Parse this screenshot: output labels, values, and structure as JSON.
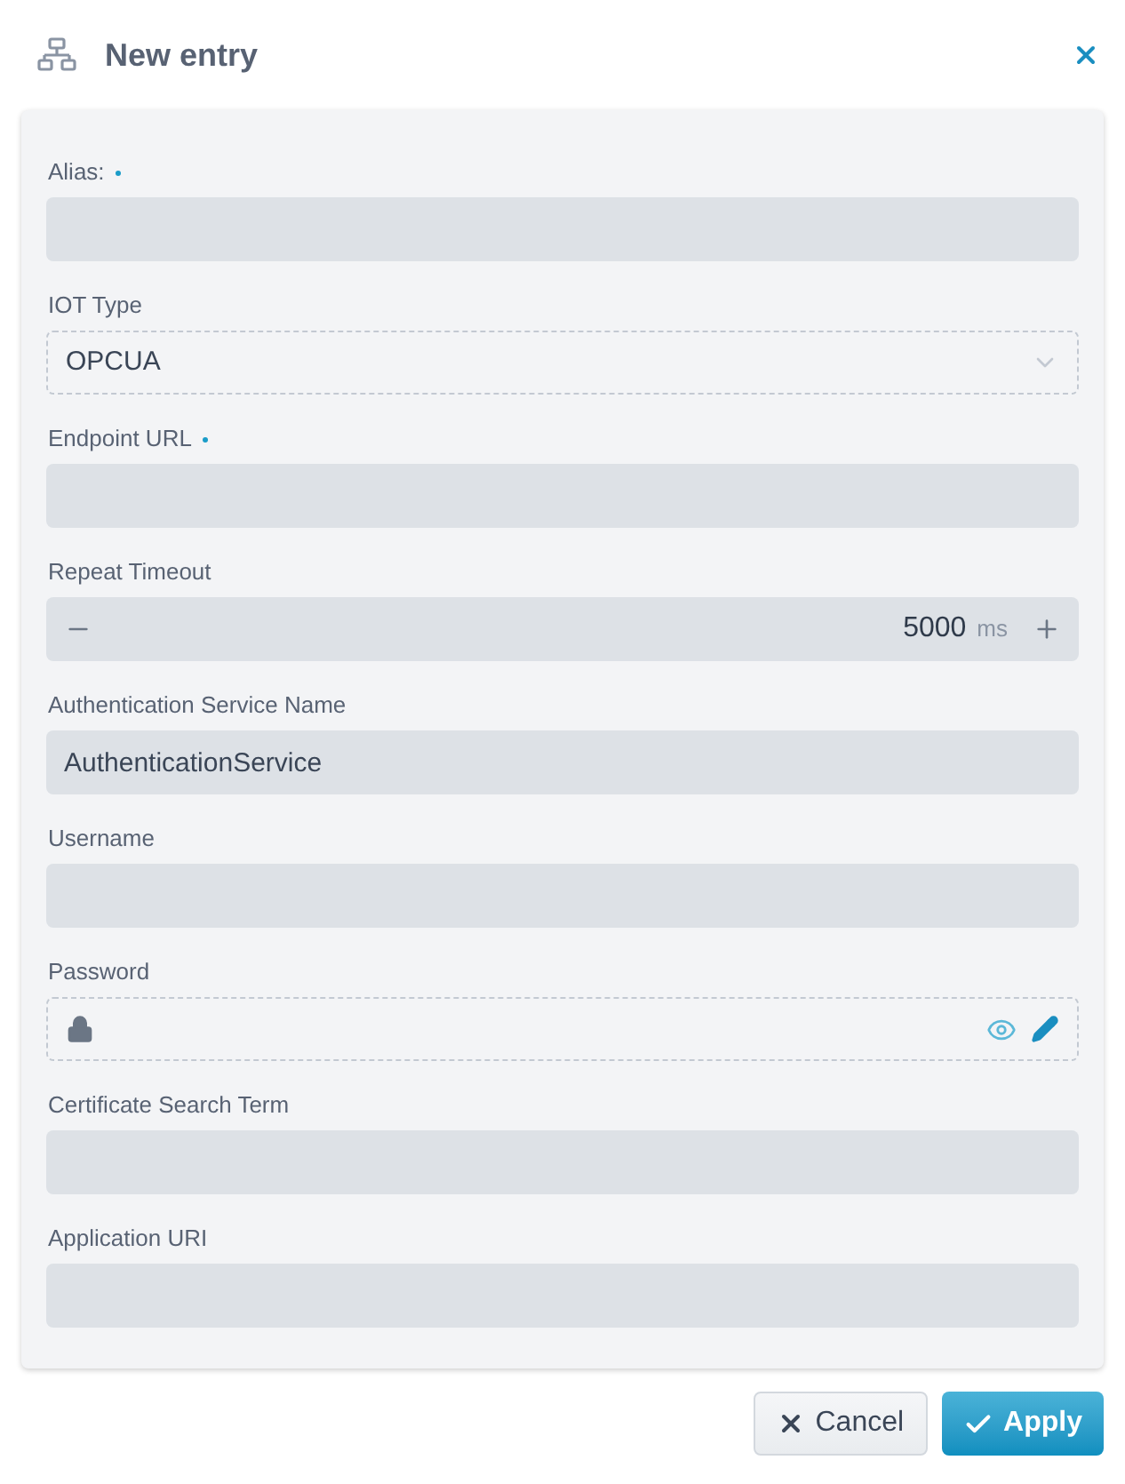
{
  "dialog": {
    "title": "New entry"
  },
  "fields": [
    {
      "kind": "text",
      "label": "Alias:",
      "required": true
    },
    {
      "kind": "select",
      "label": "IOT Type",
      "required": false,
      "value": "OPCUA"
    },
    {
      "kind": "text",
      "label": "Endpoint URL",
      "required": true
    },
    {
      "kind": "number",
      "label": "Repeat Timeout",
      "required": false,
      "value": "5000",
      "unit": "ms"
    },
    {
      "kind": "text",
      "label": "Authentication Service Name",
      "required": false,
      "value": "AuthenticationService"
    },
    {
      "kind": "text",
      "label": "Username",
      "required": false
    },
    {
      "kind": "password",
      "label": "Password",
      "required": false
    },
    {
      "kind": "text",
      "label": "Certificate Search Term",
      "required": false
    },
    {
      "kind": "text",
      "label": "Application URI",
      "required": false
    }
  ],
  "buttons": [
    {
      "kind": "cancel",
      "label": "Cancel"
    },
    {
      "kind": "apply",
      "label": "Apply"
    }
  ]
}
